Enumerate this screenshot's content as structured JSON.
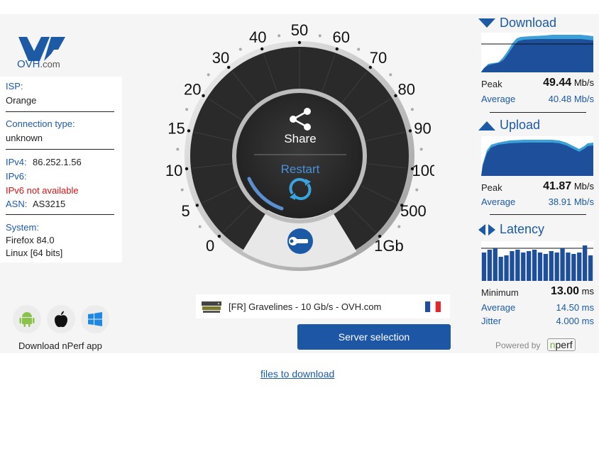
{
  "logo": {
    "name": "OVH",
    "suffix": ".com"
  },
  "info": {
    "isp_label": "ISP:",
    "isp_value": "Orange",
    "conn_label": "Connection type:",
    "conn_value": "unknown",
    "ipv4_label": "IPv4:",
    "ipv4_value": "86.252.1.56",
    "ipv6_label": "IPv6:",
    "ipv6_value": "IPv6 not available",
    "asn_label": "ASN:",
    "asn_value": "AS3215",
    "system_label": "System:",
    "browser": "Firefox 84.0",
    "os": "Linux [64 bits]"
  },
  "apps": {
    "label": "Download nPerf app",
    "icons": [
      "android-icon",
      "apple-icon",
      "windows-icon"
    ]
  },
  "gauge": {
    "ticks": [
      "0",
      "5",
      "10",
      "15",
      "20",
      "30",
      "40",
      "50",
      "60",
      "70",
      "80",
      "90",
      "100",
      "500",
      "1Gb"
    ],
    "share_label": "Share",
    "restart_label": "Restart"
  },
  "server": {
    "text": "[FR] Gravelines - 10 Gb/s - OVH.com",
    "button": "Server selection"
  },
  "download": {
    "title": "Download",
    "peak_label": "Peak",
    "peak_value": "49.44",
    "peak_unit": "Mb/s",
    "avg_label": "Average",
    "avg_value": "40.48 Mb/s"
  },
  "upload": {
    "title": "Upload",
    "peak_label": "Peak",
    "peak_value": "41.87",
    "peak_unit": "Mb/s",
    "avg_label": "Average",
    "avg_value": "38.91 Mb/s"
  },
  "latency": {
    "title": "Latency",
    "min_label": "Minimum",
    "min_value": "13.00",
    "min_unit": "ms",
    "avg_label": "Average",
    "avg_value": "14.50 ms",
    "jitter_label": "Jitter",
    "jitter_value": "4.000 ms"
  },
  "powered": {
    "label": "Powered by",
    "brand": "nperf"
  },
  "footer": {
    "link": "files to download"
  },
  "colors": {
    "accent": "#1c5aa6",
    "button": "#1c56a4",
    "error": "#d41313",
    "graph_fill": "#1d4f9b",
    "graph_peak": "#3ba0d8"
  }
}
